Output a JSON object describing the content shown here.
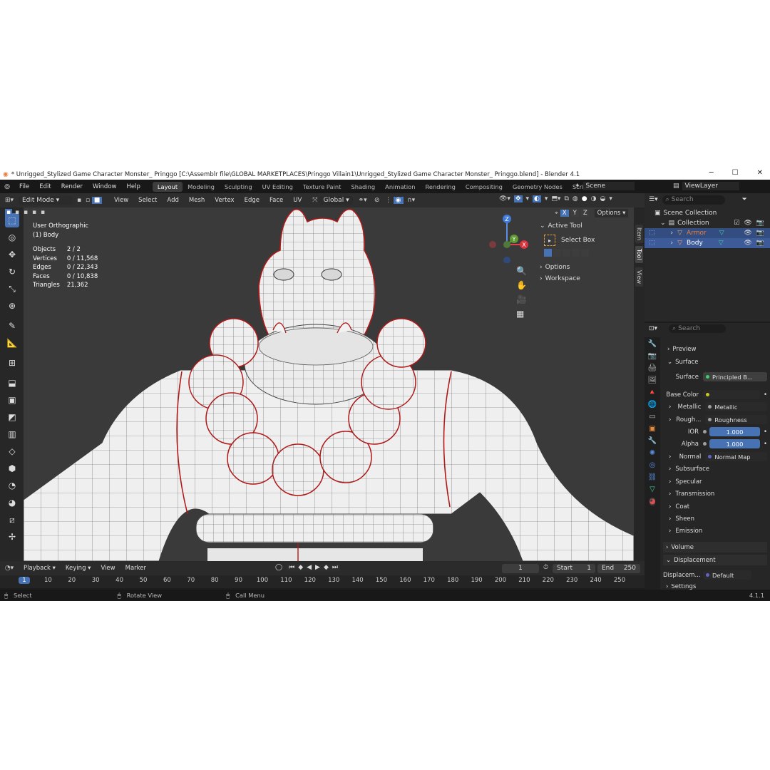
{
  "window": {
    "title": "* Unrigged_Stylized Game Character Monster_ Pringgo [C:\\Assemblr file\\GLOBAL MARKETPLACES\\Pringgo Villain1\\Unrigged_Stylized Game Character Monster_ Pringgo.blend] - Blender 4.1",
    "minimize": "─",
    "maximize": "☐",
    "close": "✕"
  },
  "menubar": {
    "items": [
      "File",
      "Edit",
      "Render",
      "Window",
      "Help"
    ],
    "workspaces": [
      "Layout",
      "Modeling",
      "Sculpting",
      "UV Editing",
      "Texture Paint",
      "Shading",
      "Animation",
      "Rendering",
      "Compositing",
      "Geometry Nodes",
      "Scripting"
    ],
    "add_tab": "+",
    "scene": "Scene",
    "viewlayer": "ViewLayer"
  },
  "viewport_header": {
    "mode": "Edit Mode",
    "menus": [
      "View",
      "Select",
      "Add",
      "Mesh",
      "Vertex",
      "Edge",
      "Face",
      "UV"
    ],
    "transform": "Global",
    "axes": [
      "X",
      "Y",
      "Z"
    ],
    "options": "Options"
  },
  "viewport": {
    "view_name": "User Orthographic",
    "object_name": "(1) Body",
    "stats": [
      {
        "label": "Objects",
        "value": "2 / 2"
      },
      {
        "label": "Vertices",
        "value": "0 / 11,568"
      },
      {
        "label": "Edges",
        "value": "0 / 22,343"
      },
      {
        "label": "Faces",
        "value": "0 / 10,838"
      },
      {
        "label": "Triangles",
        "value": "21,362"
      }
    ],
    "gizmo": {
      "z": "Z",
      "y": "Y",
      "x": "X"
    }
  },
  "npanel": {
    "active_tool": "Active Tool",
    "select_box": "Select Box",
    "options": "Options",
    "workspace": "Workspace",
    "tabs": [
      "Item",
      "Tool",
      "View"
    ]
  },
  "outliner": {
    "search_placeholder": "Search",
    "scene_collection": "Scene Collection",
    "collection": "Collection",
    "items": [
      {
        "name": "Armor",
        "color": "#e87d3e"
      },
      {
        "name": "Body",
        "color": "#e0e0e0"
      }
    ]
  },
  "properties": {
    "search_placeholder": "Search",
    "preview": "Preview",
    "surface": "Surface",
    "surface_value": "Principled B...",
    "rows": [
      {
        "label": "Base Color",
        "value": "",
        "dot": "#c7c729"
      },
      {
        "label": "Metallic",
        "value": "Metallic",
        "dot": "#a0a0a0",
        "expand": true
      },
      {
        "label": "Rough...",
        "value": "Roughness",
        "dot": "#a0a0a0",
        "expand": true
      },
      {
        "label": "IOR",
        "value": "1.000",
        "dot": "#a0a0a0",
        "blue": true
      },
      {
        "label": "Alpha",
        "value": "1.000",
        "dot": "#a0a0a0",
        "blue": true
      },
      {
        "label": "Normal",
        "value": "Normal Map",
        "dot": "#6363c7",
        "expand": true
      }
    ],
    "subpanels": [
      "Subsurface",
      "Specular",
      "Transmission",
      "Coat",
      "Sheen",
      "Emission"
    ],
    "volume": "Volume",
    "displacement": "Displacement",
    "displacement_label": "Displacem...",
    "displacement_value": "Default",
    "settings": "Settings"
  },
  "timeline": {
    "menus": [
      "Playback",
      "Keying",
      "View",
      "Marker"
    ],
    "current_frame": "1",
    "start_label": "Start",
    "start": "1",
    "end_label": "End",
    "end": "250",
    "ticks": [
      "1",
      "10",
      "20",
      "30",
      "40",
      "50",
      "60",
      "70",
      "80",
      "90",
      "100",
      "110",
      "120",
      "130",
      "140",
      "150",
      "160",
      "170",
      "180",
      "190",
      "200",
      "210",
      "220",
      "230",
      "240",
      "250"
    ]
  },
  "statusbar": {
    "select": "Select",
    "rotate": "Rotate View",
    "call_menu": "Call Menu",
    "version": "4.1.1"
  }
}
